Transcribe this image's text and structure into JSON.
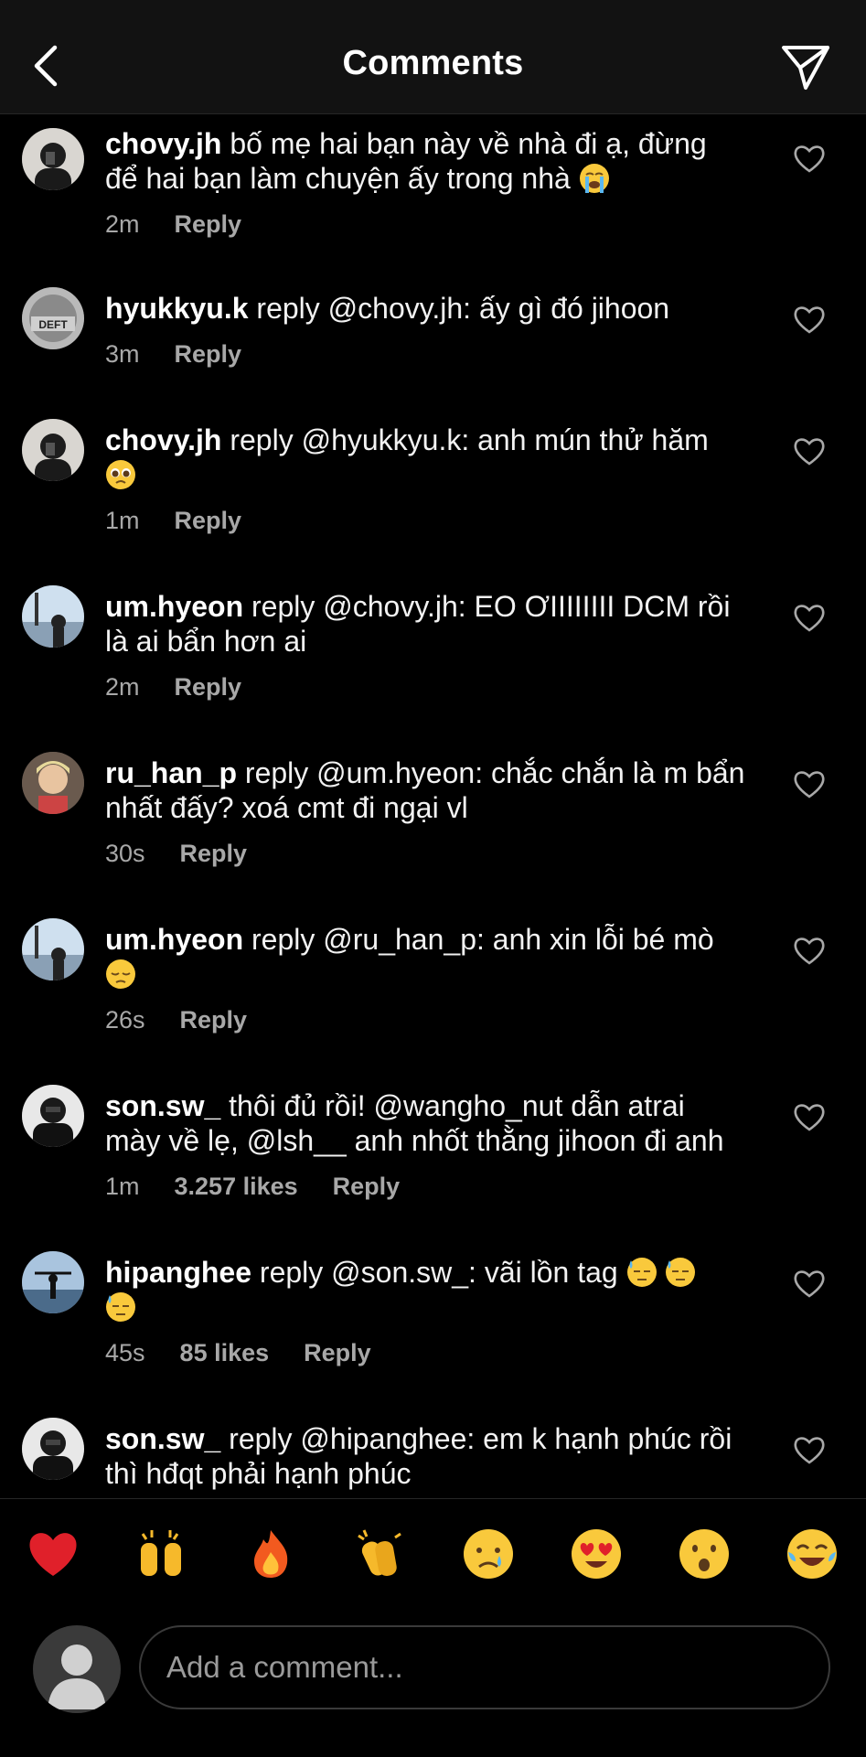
{
  "header": {
    "title": "Comments",
    "back_icon": "chevron-left-icon",
    "send_icon": "paper-plane-icon"
  },
  "comments": [
    {
      "user": "chovy.jh",
      "text": " bố mẹ hai bạn này về nhà đi ạ, đừng để hai bạn làm chuyện ấy trong nhà",
      "emoji": "loudly-crying-face",
      "time": "2m",
      "likes": "",
      "reply": "Reply"
    },
    {
      "user": "hyukkyu.k",
      "text": " reply @chovy.jh: ấy gì đó jihoon",
      "emoji": "",
      "time": "3m",
      "likes": "",
      "reply": "Reply"
    },
    {
      "user": "chovy.jh",
      "text": " reply @hyukkyu.k: anh mún thử hăm",
      "emoji": "pleading-face",
      "time": "1m",
      "likes": "",
      "reply": "Reply"
    },
    {
      "user": "um.hyeon",
      "text": " reply @chovy.jh: EO ƠIIIIIIII DCM rồi là ai bẩn hơn ai",
      "emoji": "",
      "time": "2m",
      "likes": "",
      "reply": "Reply"
    },
    {
      "user": "ru_han_p",
      "text": " reply @um.hyeon: chắc chắn là m bẩn nhất đấy? xoá cmt đi ngại vl",
      "emoji": "",
      "time": "30s",
      "likes": "",
      "reply": "Reply"
    },
    {
      "user": "um.hyeon",
      "text": " reply @ru_han_p: anh xin lỗi bé mò",
      "emoji": "pensive-face",
      "time": "26s",
      "likes": "",
      "reply": "Reply"
    },
    {
      "user": "son.sw_",
      "text": " thôi đủ rồi! @wangho_nut dẫn atrai mày về lẹ, @lsh__ anh nhốt thằng jihoon đi anh",
      "emoji": "",
      "time": "1m",
      "likes": "3.257 likes",
      "reply": "Reply"
    },
    {
      "user": "hipanghee",
      "text": " reply @son.sw_: vãi lồn tag",
      "emoji": "downcast-sweat-face x3",
      "time": "45s",
      "likes": "85 likes",
      "reply": "Reply"
    },
    {
      "user": "son.sw_",
      "text": " reply @hipanghee: em k hạnh phúc rồi thì hđqt phải hạnh phúc",
      "emoji": "",
      "time": "",
      "likes": "",
      "reply": ""
    }
  ],
  "quick_emojis": [
    "red-heart",
    "raising-hands",
    "fire",
    "clapping-hands",
    "crying-face",
    "heart-eyes-face",
    "surprised-face",
    "tears-of-joy-face"
  ],
  "composer": {
    "placeholder": "Add a comment..."
  },
  "colors": {
    "background": "#000000",
    "header": "#121212",
    "meta_text": "#a8a8a8"
  }
}
